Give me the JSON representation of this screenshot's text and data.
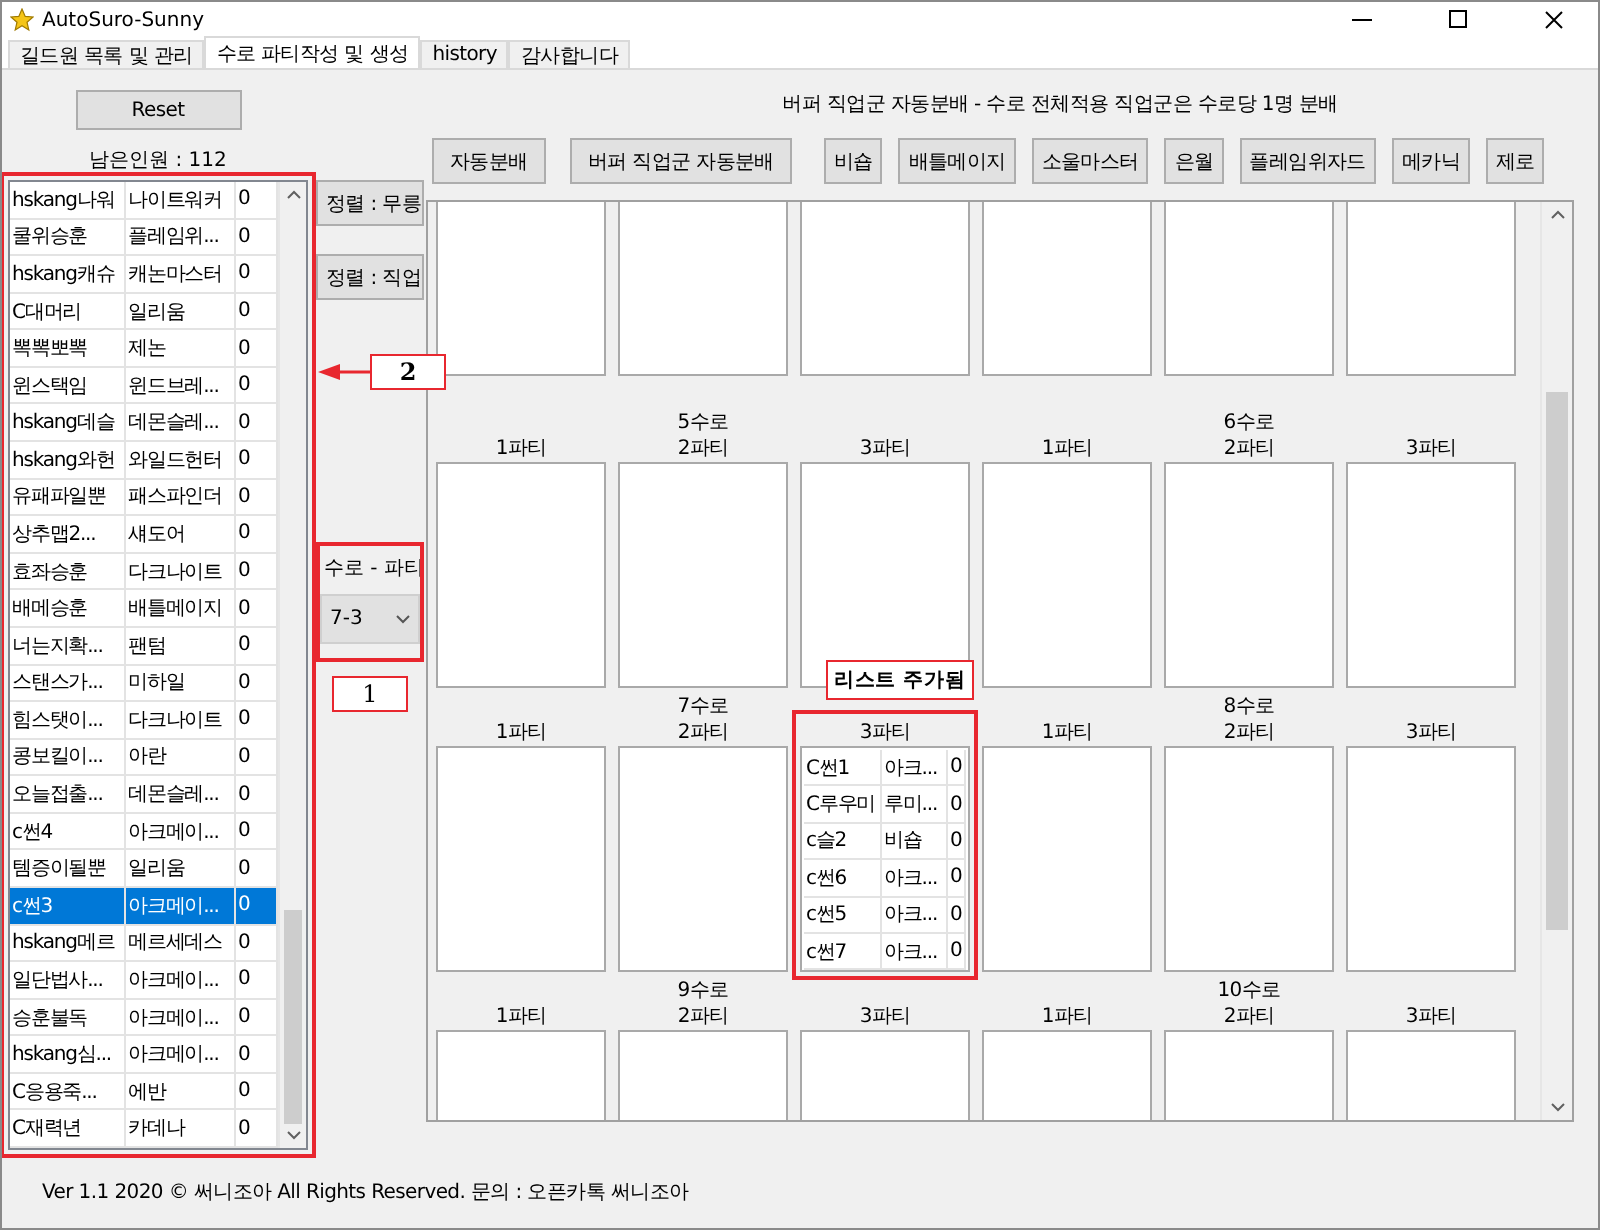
{
  "window": {
    "title": "AutoSuro-Sunny"
  },
  "tabs": [
    {
      "label": "길드원 목록 및 관리",
      "selected": false
    },
    {
      "label": "수로 파티작성 및 생성",
      "selected": true
    },
    {
      "label": "history",
      "selected": false
    },
    {
      "label": "감사합니다",
      "selected": false
    }
  ],
  "reset_button": "Reset",
  "remaining": "남은인원 : 112",
  "members_list": {
    "highlighted": true,
    "annotation": "2",
    "rows": [
      {
        "name": "hskang나워",
        "job": "나이트워커",
        "count": "0",
        "selected": false
      },
      {
        "name": "쿨위승훈",
        "job": "플레임위...",
        "count": "0",
        "selected": false
      },
      {
        "name": "hskang캐슈",
        "job": "캐논마스터",
        "count": "0",
        "selected": false
      },
      {
        "name": "C대머리",
        "job": "일리움",
        "count": "0",
        "selected": false
      },
      {
        "name": "뽁뽁뽀뽁",
        "job": "제논",
        "count": "0",
        "selected": false
      },
      {
        "name": "윈스택임",
        "job": "윈드브레...",
        "count": "0",
        "selected": false
      },
      {
        "name": "hskang데슬",
        "job": "데몬슬레...",
        "count": "0",
        "selected": false
      },
      {
        "name": "hskang와헌",
        "job": "와일드헌터",
        "count": "0",
        "selected": false
      },
      {
        "name": "유패파일뿐",
        "job": "패스파인더",
        "count": "0",
        "selected": false
      },
      {
        "name": "상추맵2...",
        "job": "섀도어",
        "count": "0",
        "selected": false
      },
      {
        "name": "효좌승훈",
        "job": "다크나이트",
        "count": "0",
        "selected": false
      },
      {
        "name": "배메승훈",
        "job": "배틀메이지",
        "count": "0",
        "selected": false
      },
      {
        "name": "너는지확...",
        "job": "팬텀",
        "count": "0",
        "selected": false
      },
      {
        "name": "스탠스가...",
        "job": "미하일",
        "count": "0",
        "selected": false
      },
      {
        "name": "힘스탯이...",
        "job": "다크나이트",
        "count": "0",
        "selected": false
      },
      {
        "name": "콩보킬이...",
        "job": "아란",
        "count": "0",
        "selected": false
      },
      {
        "name": "오늘접출...",
        "job": "데몬슬레...",
        "count": "0",
        "selected": false
      },
      {
        "name": "c썬4",
        "job": "아크메이...",
        "count": "0",
        "selected": false
      },
      {
        "name": "템증이될뿐",
        "job": "일리움",
        "count": "0",
        "selected": false
      },
      {
        "name": "c썬3",
        "job": "아크메이...",
        "count": "0",
        "selected": true
      },
      {
        "name": "hskang메르",
        "job": "메르세데스",
        "count": "0",
        "selected": false
      },
      {
        "name": "일단법사...",
        "job": "아크메이...",
        "count": "0",
        "selected": false
      },
      {
        "name": "승훈불독",
        "job": "아크메이...",
        "count": "0",
        "selected": false
      },
      {
        "name": "hskang심...",
        "job": "아크메이...",
        "count": "0",
        "selected": false
      },
      {
        "name": "C응용죽...",
        "job": "에반",
        "count": "0",
        "selected": false
      },
      {
        "name": "C재력년",
        "job": "카데나",
        "count": "0",
        "selected": false
      }
    ]
  },
  "sort_buttons": [
    "정렬 : 무릉",
    "정렬 : 직업"
  ],
  "route_party": {
    "label": "수로 - 파티",
    "value": "7-3",
    "highlighted": true,
    "annotation": "1"
  },
  "notice": "버퍼 직업군 자동분배 - 수로 전체적용 직업군은 수로당 1명 분배",
  "auto_buttons": [
    "자동분배",
    "버퍼 직업군 자동분배"
  ],
  "class_buttons": [
    "비숍",
    "배틀메이지",
    "소울마스터",
    "은월",
    "플레임위자드",
    "메카닉",
    "제로"
  ],
  "route_rows": [
    {
      "routes": [
        {
          "name": "5수로",
          "parties": [
            {
              "label": "1파티",
              "highlighted": false
            },
            {
              "label": "2파티",
              "highlighted": false
            },
            {
              "label": "3파티",
              "highlighted": false
            }
          ]
        },
        {
          "name": "6수로",
          "parties": [
            {
              "label": "1파티",
              "highlighted": false
            },
            {
              "label": "2파티",
              "highlighted": false
            },
            {
              "label": "3파티",
              "highlighted": false
            }
          ]
        }
      ]
    },
    {
      "routes": [
        {
          "name": "7수로",
          "parties": [
            {
              "label": "1파티",
              "highlighted": false
            },
            {
              "label": "2파티",
              "highlighted": false
            },
            {
              "label": "3파티",
              "highlighted": true,
              "note": "리스트 주가됨",
              "members": [
                {
                  "name": "C썬1",
                  "job": "아크...",
                  "count": "0"
                },
                {
                  "name": "C루우미",
                  "job": "루미...",
                  "count": "0"
                },
                {
                  "name": "c슬2",
                  "job": "비숍",
                  "count": "0"
                },
                {
                  "name": "c썬6",
                  "job": "아크...",
                  "count": "0"
                },
                {
                  "name": "c썬5",
                  "job": "아크...",
                  "count": "0"
                },
                {
                  "name": "c썬7",
                  "job": "아크...",
                  "count": "0"
                }
              ]
            }
          ]
        },
        {
          "name": "8수로",
          "parties": [
            {
              "label": "1파티",
              "highlighted": false
            },
            {
              "label": "2파티",
              "highlighted": false
            },
            {
              "label": "3파티",
              "highlighted": false
            }
          ]
        }
      ]
    },
    {
      "routes": [
        {
          "name": "9수로",
          "parties": [
            {
              "label": "1파티",
              "highlighted": false
            },
            {
              "label": "2파티",
              "highlighted": false
            },
            {
              "label": "3파티",
              "highlighted": false
            }
          ]
        },
        {
          "name": "10수로",
          "parties": [
            {
              "label": "1파티",
              "highlighted": false
            },
            {
              "label": "2파티",
              "highlighted": false
            },
            {
              "label": "3파티",
              "highlighted": false
            }
          ]
        }
      ]
    }
  ],
  "footer": "Ver 1.1  2020 © 써니조아 All Rights Reserved. 문의 : 오픈카톡 써니조아"
}
